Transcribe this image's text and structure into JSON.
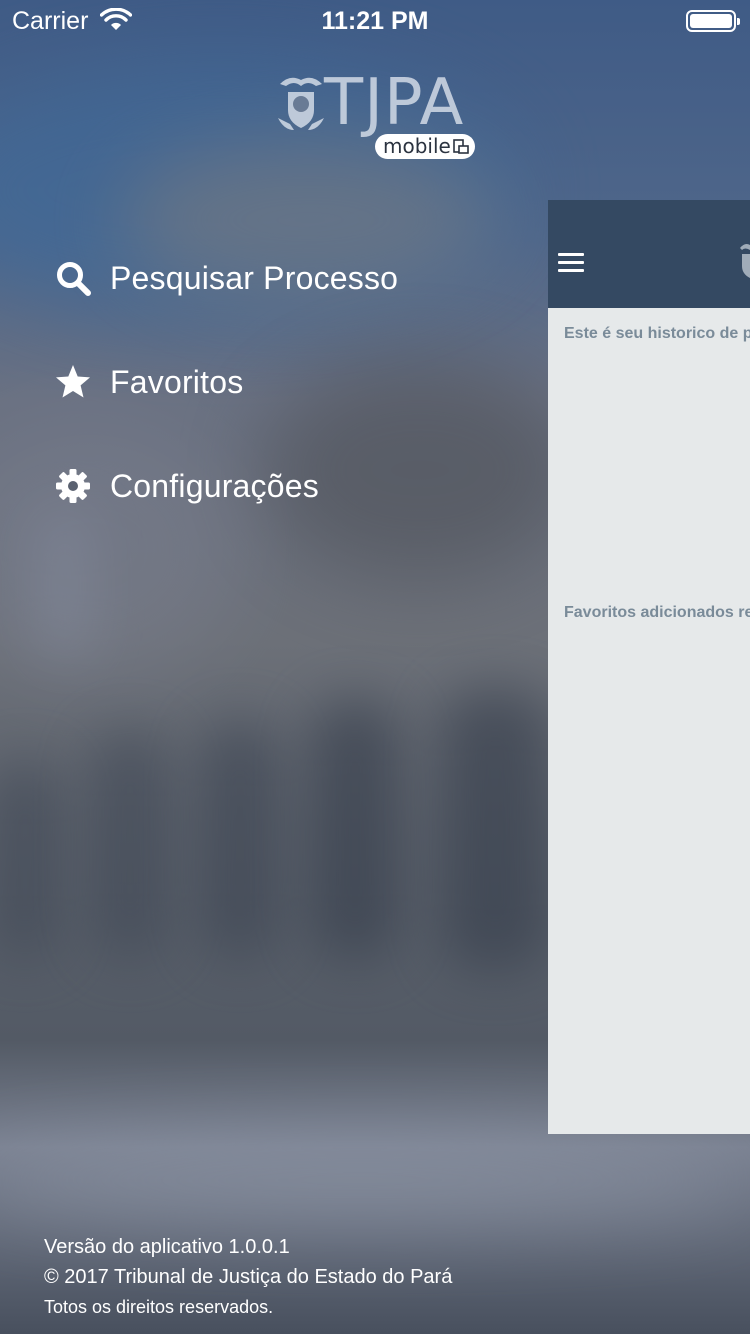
{
  "status_bar": {
    "carrier": "Carrier",
    "time": "11:21 PM"
  },
  "logo": {
    "wordmark": "TJPA",
    "badge": "mobile"
  },
  "menu": {
    "items": [
      {
        "label": "Pesquisar Processo",
        "icon": "search-icon"
      },
      {
        "label": "Favoritos",
        "icon": "star-icon"
      },
      {
        "label": "Configurações",
        "icon": "gear-icon"
      }
    ]
  },
  "panel": {
    "history_title": "Este é seu historico de pesq",
    "favorites_title": "Favoritos adicionados recen"
  },
  "footer": {
    "version": "Versão do aplicativo 1.0.0.1",
    "copyright": "© 2017 Tribunal de Justiça do Estado do Pará",
    "rights": "Totos os direitos reservados."
  },
  "colors": {
    "navbar": "#344962",
    "panel_bg": "#e6e9ea",
    "section_title": "#7a8b99"
  }
}
